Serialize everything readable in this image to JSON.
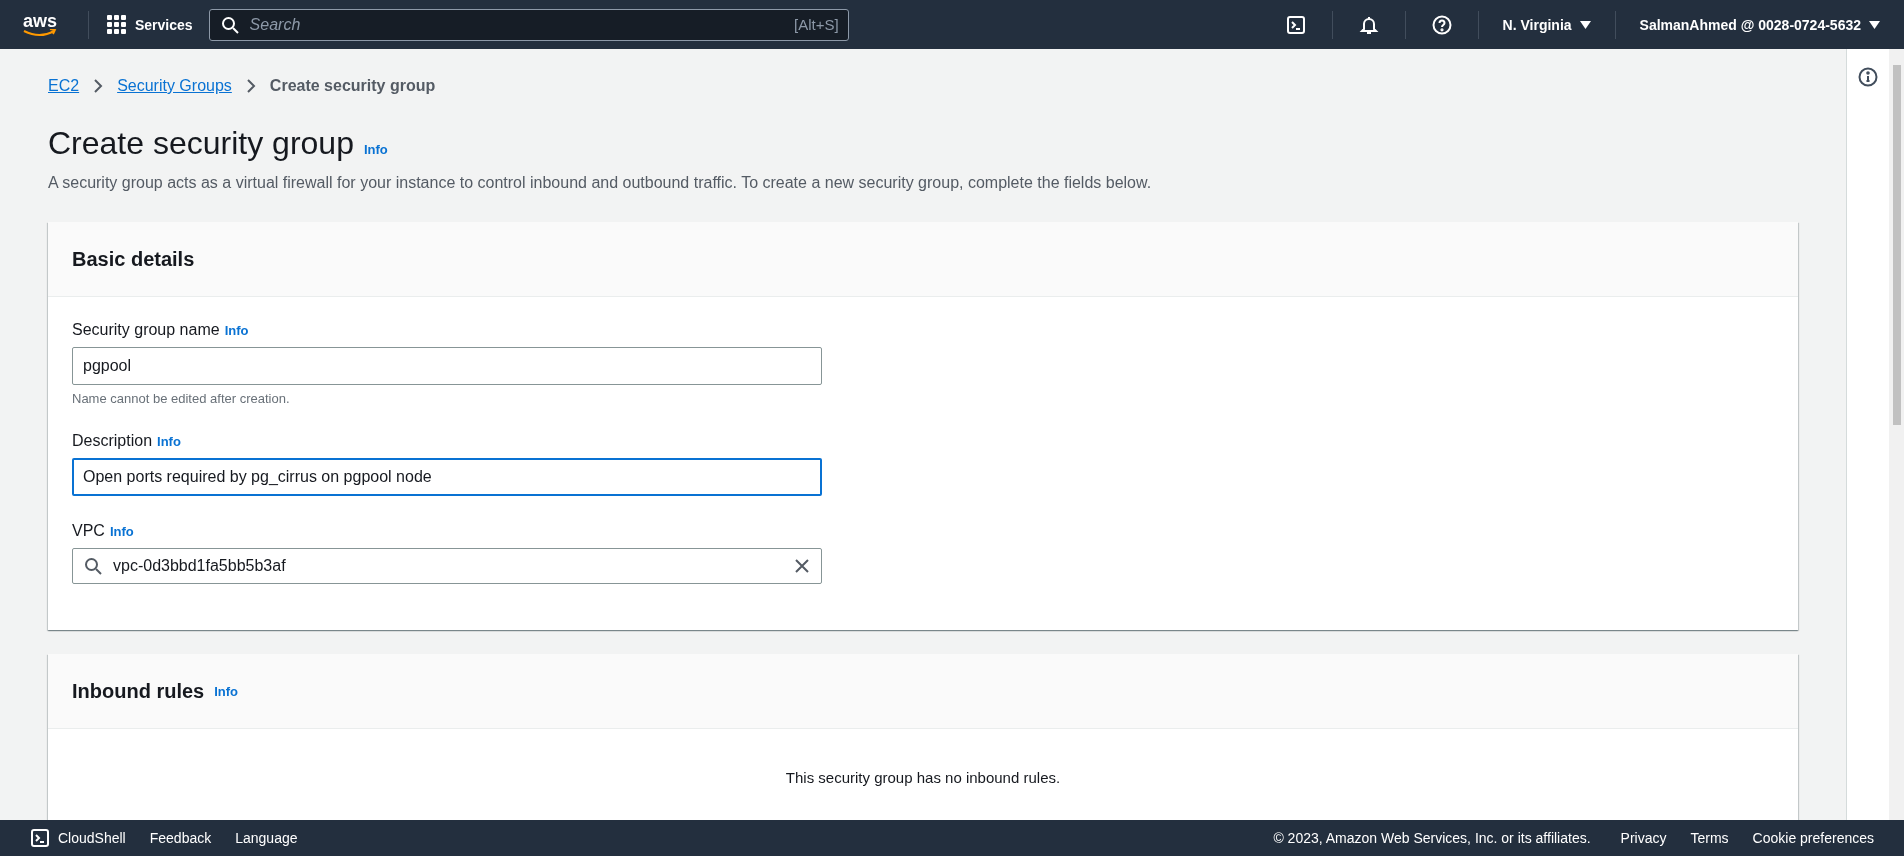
{
  "top_bar": {
    "logo": "aws",
    "services": "Services",
    "search": {
      "placeholder": "Search",
      "shortcut": "[Alt+S]"
    },
    "region": "N. Virginia",
    "account": "SalmanAhmed @ 0028-0724-5632"
  },
  "breadcrumb": [
    {
      "label": "EC2",
      "link": true
    },
    {
      "label": "Security Groups",
      "link": true
    },
    {
      "label": "Create security group",
      "link": false
    }
  ],
  "page": {
    "title": "Create security group",
    "info": "Info",
    "description": "A security group acts as a virtual firewall for your instance to control inbound and outbound traffic. To create a new security group, complete the fields below."
  },
  "sections": [
    {
      "title": "Basic details",
      "fields": [
        {
          "kind": "text",
          "label": "Security group name",
          "info": "Info",
          "value": "pgpool",
          "hint": "Name cannot be edited after creation.",
          "focused": false
        },
        {
          "kind": "text",
          "label": "Description",
          "info": "Info",
          "value": "Open ports required by pg_cirrus on pgpool node",
          "focused": true
        },
        {
          "kind": "search",
          "label": "VPC",
          "info": "Info",
          "value": "vpc-0d3bbd1fa5bb5b3af",
          "focused": false
        }
      ]
    },
    {
      "title": "Inbound rules",
      "info": "Info",
      "empty_text": "This security group has no inbound rules."
    }
  ],
  "footer": {
    "left": [
      "CloudShell",
      "Feedback",
      "Language"
    ],
    "copyright": "© 2023, Amazon Web Services, Inc. or its affiliates.",
    "right": [
      "Privacy",
      "Terms",
      "Cookie preferences"
    ]
  }
}
